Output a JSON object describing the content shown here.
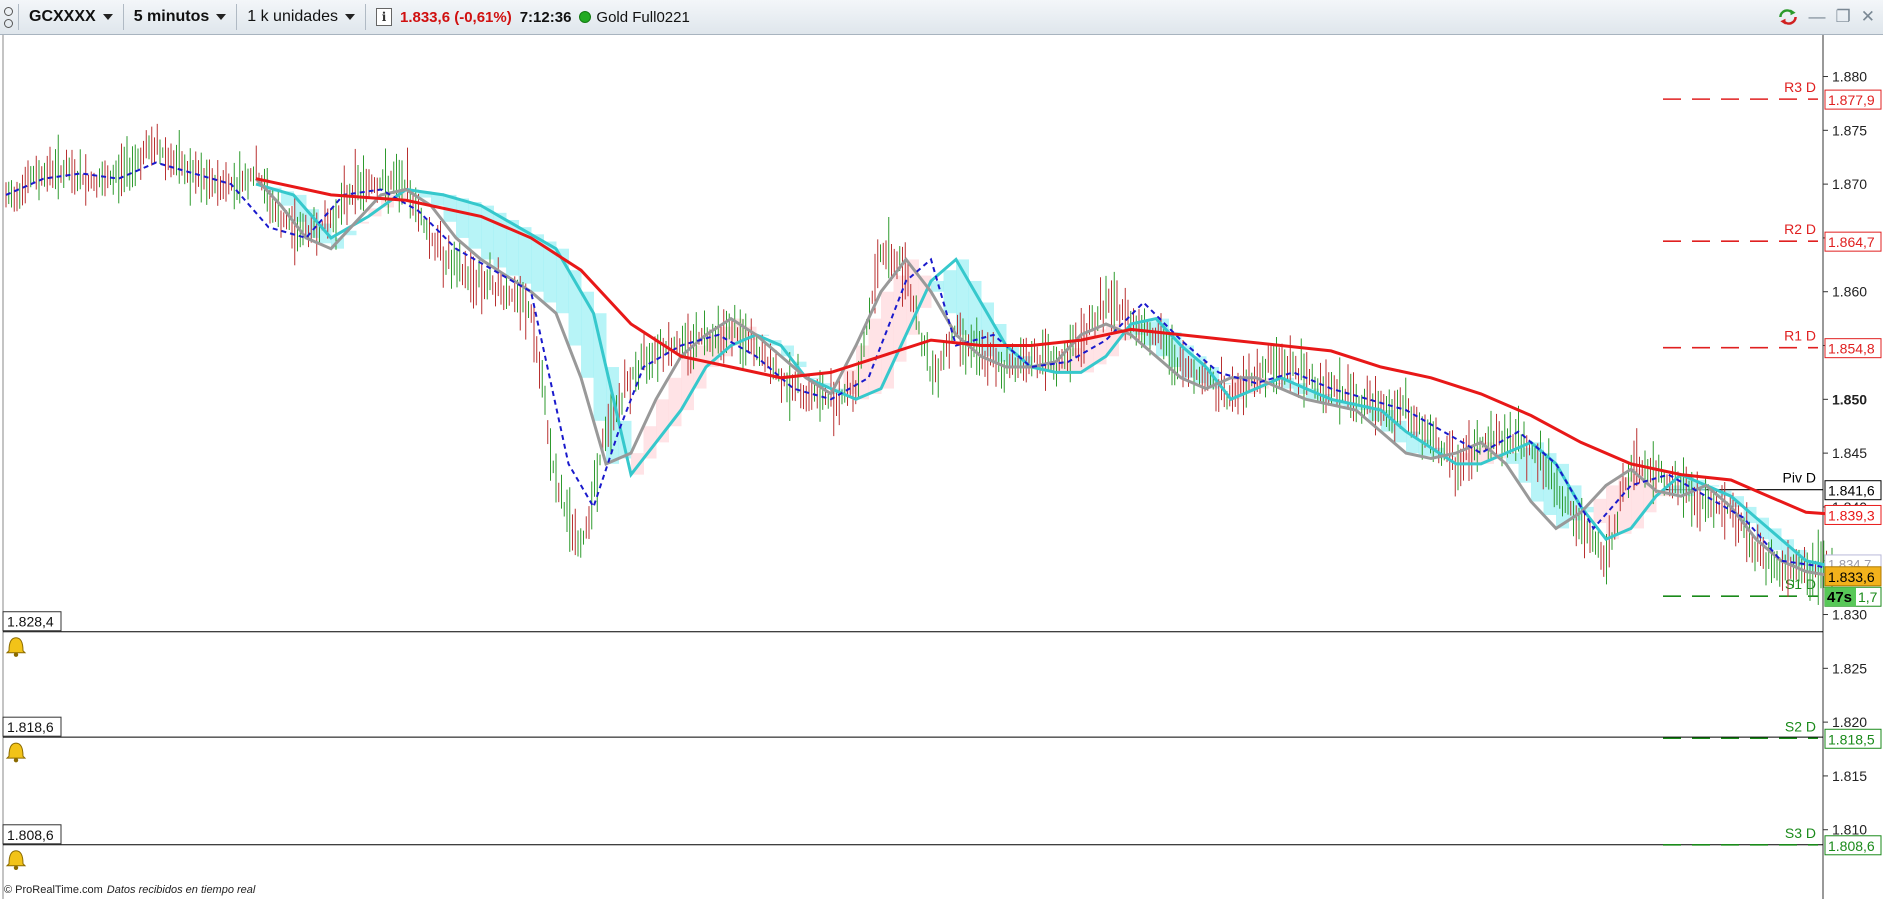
{
  "toolbar": {
    "symbol": "GCXXXX",
    "interval": "5 minutos",
    "units": "1 k unidades",
    "last_price": "1.833,6 (-0,61%)",
    "clock": "7:12:36",
    "instrument": "Gold Full0221",
    "info_label": "i"
  },
  "footer": {
    "brand": "© ProRealTime.com",
    "status": "Datos recibidos en tiempo real"
  },
  "alerts": [
    {
      "level": "1.828,4",
      "icon": "bell-icon"
    },
    {
      "level": "1.818,6",
      "icon": "bell-icon"
    },
    {
      "level": "1.808,6",
      "icon": "bell-icon"
    }
  ],
  "colors": {
    "resistance": "#e02020",
    "support": "#1a8a1a",
    "ma_red": "#e81818",
    "ma_gray": "#999999",
    "tenkan": "#1a1acc",
    "cloud_cyan": "#9ff0f4",
    "cloud_pink": "#ffd9dd",
    "kijun": "#36c8cc",
    "price_badge": "#f2b21c",
    "timer_badge": "#58c858"
  },
  "chart_data": {
    "type": "line",
    "y_ticks": [
      "1.880",
      "1.875",
      "1.870",
      "1.865",
      "1.860",
      "1.855",
      "1.850",
      "1.845",
      "1.840",
      "1.835",
      "1.830",
      "1.825",
      "1.820",
      "1.815",
      "1.810"
    ],
    "ylim": [
      1.807,
      1.882
    ],
    "pivots": [
      {
        "label": "R3 D",
        "value": "1.877,9",
        "y": 1.8779,
        "kind": "resistance"
      },
      {
        "label": "R2 D",
        "value": "1.864,7",
        "y": 1.8647,
        "kind": "resistance"
      },
      {
        "label": "R1 D",
        "value": "1.854,8",
        "y": 1.8548,
        "kind": "resistance"
      },
      {
        "label": "Piv D",
        "value": "1.841,6",
        "y": 1.8416,
        "kind": "pivot"
      },
      {
        "label": "S1 D",
        "value": "1.831,7",
        "y": 1.8317,
        "kind": "support"
      },
      {
        "label": "S2 D",
        "value": "1.818,5",
        "y": 1.8185,
        "kind": "support"
      },
      {
        "label": "S3 D",
        "value": "1.808,6",
        "y": 1.8086,
        "kind": "support"
      }
    ],
    "last_badge": "1.833,6",
    "ma_badge": "1.839,3",
    "timer_badge": "47s",
    "hidden_badges": [
      "1.834,7"
    ],
    "price_x": [
      0,
      20,
      40,
      60,
      80,
      100,
      120,
      140,
      160,
      180,
      200,
      220,
      240,
      260,
      280,
      300,
      320,
      340,
      360,
      380,
      400,
      420,
      440,
      460,
      480,
      500,
      520,
      540,
      560,
      580,
      600,
      620,
      640,
      660,
      680,
      700,
      720,
      740,
      760,
      780,
      800,
      820,
      840,
      860,
      880,
      900,
      920,
      940,
      960,
      980,
      1000,
      1020,
      1040,
      1060,
      1080,
      1100,
      1120,
      1140,
      1160,
      1180,
      1200,
      1220,
      1240,
      1260,
      1280,
      1300,
      1320,
      1340,
      1360,
      1380,
      1400,
      1420,
      1440,
      1460
    ],
    "price_y": [
      1.8685,
      1.8705,
      1.8715,
      1.8705,
      1.87,
      1.872,
      1.8735,
      1.8715,
      1.87,
      1.87,
      1.871,
      1.8665,
      1.8655,
      1.8665,
      1.87,
      1.87,
      1.87,
      1.865,
      1.862,
      1.861,
      1.86,
      1.858,
      1.842,
      1.836,
      1.847,
      1.852,
      1.855,
      1.855,
      1.856,
      1.8565,
      1.8545,
      1.852,
      1.8505,
      1.85,
      1.851,
      1.864,
      1.862,
      1.852,
      1.8565,
      1.854,
      1.853,
      1.854,
      1.853,
      1.8555,
      1.859,
      1.8575,
      1.856,
      1.853,
      1.852,
      1.85,
      1.8525,
      1.8535,
      1.852,
      1.851,
      1.85,
      1.849,
      1.849,
      1.846,
      1.844,
      1.846,
      1.8465,
      1.8455,
      1.842,
      1.838,
      1.835,
      1.844,
      1.843,
      1.842,
      1.84,
      1.84,
      1.836,
      1.834,
      1.8345,
      1.834
    ],
    "ma_red_x": [
      200,
      260,
      320,
      380,
      420,
      460,
      500,
      540,
      580,
      620,
      660,
      700,
      740,
      780,
      820,
      860,
      900,
      940,
      980,
      1020,
      1060,
      1100,
      1140,
      1180,
      1220,
      1260,
      1300,
      1340,
      1380,
      1410,
      1440,
      1465
    ],
    "ma_red_y": [
      1.8705,
      1.869,
      1.8685,
      1.867,
      1.865,
      1.862,
      1.857,
      1.854,
      1.853,
      1.852,
      1.8525,
      1.854,
      1.8555,
      1.855,
      1.855,
      1.8555,
      1.8565,
      1.856,
      1.8555,
      1.855,
      1.8545,
      1.853,
      1.852,
      1.8505,
      1.8485,
      1.846,
      1.844,
      1.843,
      1.8425,
      1.841,
      1.8395,
      1.8393
    ],
    "ma_gray_x": [
      200,
      220,
      240,
      260,
      280,
      300,
      320,
      340,
      360,
      380,
      400,
      420,
      440,
      460,
      480,
      500,
      520,
      540,
      560,
      580,
      600,
      620,
      640,
      660,
      680,
      700,
      720,
      740,
      760,
      780,
      800,
      820,
      840,
      860,
      880,
      900,
      920,
      940,
      960,
      980,
      1000,
      1020,
      1040,
      1060,
      1080,
      1100,
      1120,
      1140,
      1160,
      1180,
      1200,
      1220,
      1240,
      1260,
      1280,
      1300,
      1320,
      1340,
      1360,
      1380,
      1400,
      1420,
      1440,
      1465
    ],
    "ma_gray_y": [
      1.8705,
      1.868,
      1.865,
      1.864,
      1.8665,
      1.869,
      1.8695,
      1.868,
      1.865,
      1.863,
      1.8615,
      1.86,
      1.858,
      1.852,
      1.844,
      1.845,
      1.85,
      1.854,
      1.856,
      1.8575,
      1.856,
      1.854,
      1.852,
      1.8505,
      1.855,
      1.86,
      1.863,
      1.86,
      1.856,
      1.854,
      1.853,
      1.853,
      1.8535,
      1.856,
      1.857,
      1.856,
      1.854,
      1.852,
      1.851,
      1.852,
      1.852,
      1.851,
      1.85,
      1.8495,
      1.849,
      1.847,
      1.845,
      1.8445,
      1.845,
      1.846,
      1.844,
      1.8405,
      1.838,
      1.8395,
      1.842,
      1.8435,
      1.8415,
      1.841,
      1.842,
      1.84,
      1.837,
      1.835,
      1.834,
      1.8335
    ],
    "tenkan_x": [
      0,
      30,
      60,
      90,
      120,
      150,
      180,
      210,
      240,
      270,
      300,
      330,
      360,
      390,
      420,
      450,
      470,
      490,
      510,
      540,
      570,
      600,
      630,
      660,
      690,
      720,
      740,
      760,
      790,
      820,
      850,
      880,
      910,
      940,
      970,
      1000,
      1030,
      1060,
      1090,
      1120,
      1150,
      1180,
      1210,
      1240,
      1270,
      1300,
      1330,
      1360,
      1390,
      1420,
      1450,
      1465
    ],
    "tenkan_y": [
      1.869,
      1.8705,
      1.871,
      1.8705,
      1.872,
      1.871,
      1.87,
      1.866,
      1.865,
      1.869,
      1.8695,
      1.8675,
      1.864,
      1.862,
      1.86,
      1.844,
      1.84,
      1.847,
      1.853,
      1.855,
      1.856,
      1.854,
      1.851,
      1.85,
      1.852,
      1.861,
      1.863,
      1.855,
      1.856,
      1.853,
      1.8535,
      1.8555,
      1.859,
      1.8555,
      1.8525,
      1.8515,
      1.8525,
      1.851,
      1.85,
      1.849,
      1.847,
      1.845,
      1.847,
      1.844,
      1.838,
      1.842,
      1.843,
      1.841,
      1.839,
      1.835,
      1.8345,
      1.834
    ],
    "kijun_x": [
      200,
      230,
      260,
      290,
      320,
      350,
      380,
      410,
      440,
      470,
      500,
      520,
      540,
      560,
      580,
      600,
      620,
      640,
      660,
      680,
      700,
      720,
      740,
      760,
      780,
      800,
      820,
      840,
      860,
      880,
      900,
      920,
      940,
      960,
      980,
      1000,
      1020,
      1040,
      1060,
      1080,
      1100,
      1120,
      1140,
      1160,
      1180,
      1200,
      1220,
      1240,
      1260,
      1280,
      1300,
      1320,
      1340,
      1360,
      1380,
      1400,
      1420,
      1440,
      1460
    ],
    "kijun_y": [
      1.87,
      1.869,
      1.865,
      1.867,
      1.8695,
      1.869,
      1.868,
      1.866,
      1.864,
      1.858,
      1.843,
      1.846,
      1.849,
      1.853,
      1.855,
      1.856,
      1.855,
      1.852,
      1.851,
      1.85,
      1.851,
      1.856,
      1.861,
      1.863,
      1.859,
      1.855,
      1.853,
      1.8525,
      1.8525,
      1.854,
      1.857,
      1.8575,
      1.855,
      1.853,
      1.85,
      1.851,
      1.852,
      1.851,
      1.85,
      1.8495,
      1.849,
      1.847,
      1.8455,
      1.844,
      1.844,
      1.845,
      1.846,
      1.844,
      1.84,
      1.837,
      1.838,
      1.841,
      1.843,
      1.842,
      1.841,
      1.839,
      1.837,
      1.835,
      1.8345
    ]
  }
}
